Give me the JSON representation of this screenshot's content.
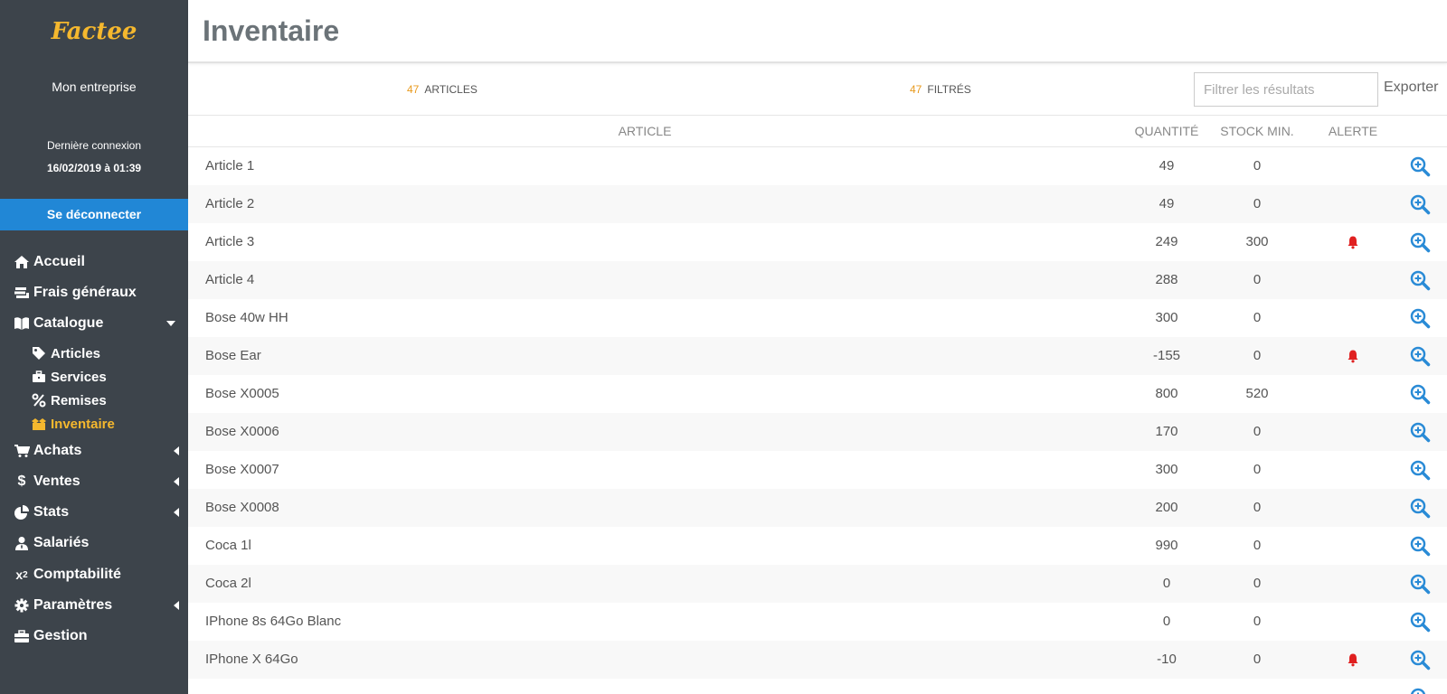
{
  "brand": {
    "logo": "Factee",
    "company": "Mon entreprise"
  },
  "session": {
    "last_label": "Dernière connexion",
    "last_date": "16/02/2019 à 01:39",
    "logout": "Se déconnecter"
  },
  "nav": {
    "accueil": "Accueil",
    "frais": "Frais généraux",
    "catalogue": "Catalogue",
    "articles": "Articles",
    "services": "Services",
    "remises": "Remises",
    "inventaire": "Inventaire",
    "achats": "Achats",
    "ventes": "Ventes",
    "stats": "Stats",
    "salaries": "Salariés",
    "comptabilite": "Comptabilité",
    "parametres": "Paramètres",
    "gestion": "Gestion"
  },
  "page": {
    "title": "Inventaire"
  },
  "toolbar": {
    "articles_count": "47",
    "articles_label": "ARTICLES",
    "filtered_count": "47",
    "filtered_label": "FILTRÉS",
    "filter_placeholder": "Filtrer les résultats",
    "export": "Exporter"
  },
  "table": {
    "headers": {
      "article": "ARTICLE",
      "quantity": "QUANTITÉ",
      "stock_min": "STOCK MIN.",
      "alert": "ALERTE"
    },
    "rows": [
      {
        "name": "Article 1",
        "qty": "49",
        "min": "0",
        "alert": false
      },
      {
        "name": "Article 2",
        "qty": "49",
        "min": "0",
        "alert": false
      },
      {
        "name": "Article 3",
        "qty": "249",
        "min": "300",
        "alert": true
      },
      {
        "name": "Article 4",
        "qty": "288",
        "min": "0",
        "alert": false
      },
      {
        "name": "Bose 40w HH",
        "qty": "300",
        "min": "0",
        "alert": false
      },
      {
        "name": "Bose Ear",
        "qty": "-155",
        "min": "0",
        "alert": true
      },
      {
        "name": "Bose X0005",
        "qty": "800",
        "min": "520",
        "alert": false
      },
      {
        "name": "Bose X0006",
        "qty": "170",
        "min": "0",
        "alert": false
      },
      {
        "name": "Bose X0007",
        "qty": "300",
        "min": "0",
        "alert": false
      },
      {
        "name": "Bose X0008",
        "qty": "200",
        "min": "0",
        "alert": false
      },
      {
        "name": "Coca 1l",
        "qty": "990",
        "min": "0",
        "alert": false
      },
      {
        "name": "Coca 2l",
        "qty": "0",
        "min": "0",
        "alert": false
      },
      {
        "name": "IPhone 8s 64Go Blanc",
        "qty": "0",
        "min": "0",
        "alert": false
      },
      {
        "name": "IPhone X 64Go",
        "qty": "-10",
        "min": "0",
        "alert": true
      },
      {
        "name": "",
        "qty": "",
        "min": "",
        "alert": false
      }
    ]
  },
  "colors": {
    "sidebar": "#3d444b",
    "accent": "#f5b82e",
    "logout": "#2187d6",
    "count": "#e89a1e",
    "alert": "#e02020",
    "view": "#2a8bd6"
  },
  "icons": {
    "alert": "bell-icon",
    "view": "zoom-in-icon"
  }
}
